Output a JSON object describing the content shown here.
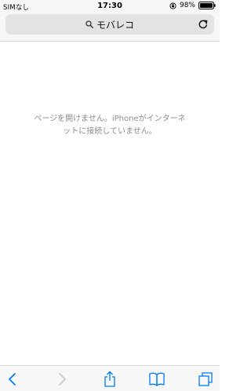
{
  "status": {
    "carrier": "SIMなし",
    "time": "17:30",
    "battery": "98%"
  },
  "address": {
    "site_title": "モバレコ"
  },
  "error": {
    "line1": "ページを開けません。iPhoneがインターネ",
    "line2": "ットに接続していません。"
  },
  "toolbar": {
    "back_icon": "chevron-left-icon",
    "forward_icon": "chevron-right-icon",
    "share_icon": "share-icon",
    "bookmarks_icon": "book-icon",
    "tabs_icon": "tabs-icon"
  },
  "colors": {
    "accent": "#007aff",
    "disabled": "#c7c7cc",
    "message": "#8e8e93"
  }
}
